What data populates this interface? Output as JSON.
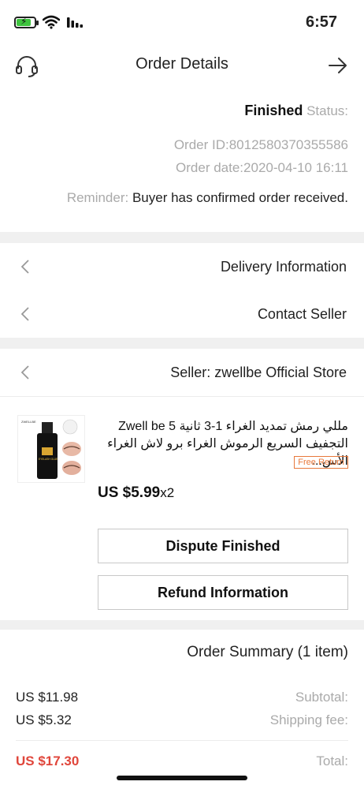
{
  "status_bar": {
    "time": "6:57"
  },
  "nav": {
    "title": "Order Details"
  },
  "order": {
    "status_label": "Status:",
    "status_value": "Finished",
    "order_id": "Order ID:8012580370355586",
    "order_date": "Order date:2020-04-10 16:11",
    "reminder_label": "Reminder:",
    "reminder_text": "Buyer has confirmed order received."
  },
  "rows": {
    "delivery": "Delivery Information",
    "contact": "Contact Seller",
    "seller": "Seller: zwellbe Official Store"
  },
  "product": {
    "title": "مللي رمش تمديد الغراء 1-3 ثانية Zwell be 5 التجفيف السريع الرموش الغراء برو لاش الغراء الأس...",
    "free_return": "Free Return",
    "price": "US $5.99",
    "quantity": "x2",
    "image_brand": "ZWELLBE",
    "image_label": "EYELASH GLUE"
  },
  "buttons": {
    "dispute": "Dispute Finished",
    "refund": "Refund Information"
  },
  "summary": {
    "title": "Order Summary (1 item)",
    "subtotal_label": "Subtotal:",
    "subtotal_value": "US $11.98",
    "shipping_label": "Shipping fee:",
    "shipping_value": "US $5.32",
    "total_label": "Total:",
    "total_value": "US $17.30"
  },
  "colors": {
    "accent_red": "#e0463b",
    "free_return_orange": "#e8793c",
    "battery_green": "#3ec33e"
  },
  "icons": [
    "battery-icon",
    "wifi-icon",
    "signal-icon",
    "headset-icon",
    "arrow-right-icon",
    "chevron-left-icon"
  ]
}
